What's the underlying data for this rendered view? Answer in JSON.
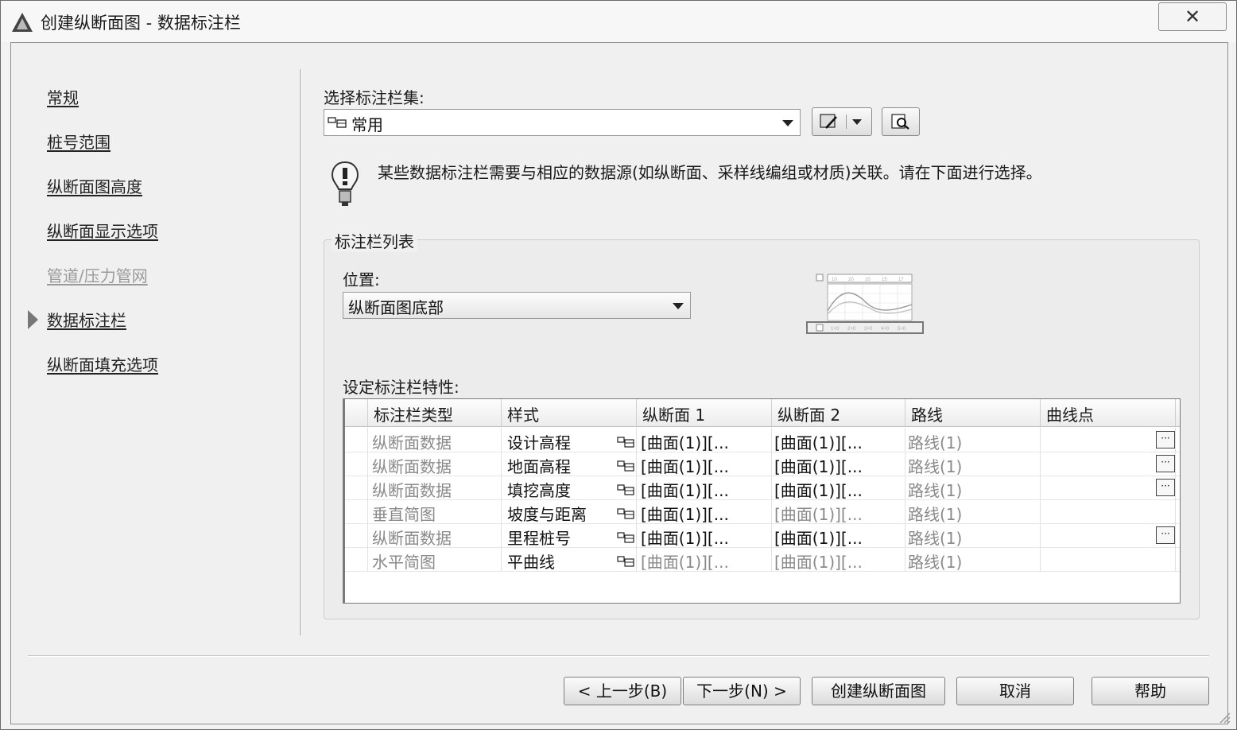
{
  "window": {
    "title": "创建纵断面图 - 数据标注栏",
    "close_glyph": "✕"
  },
  "nav": {
    "items": [
      {
        "label": "常规",
        "enabled": true
      },
      {
        "label": "桩号范围",
        "enabled": true
      },
      {
        "label": "纵断面图高度",
        "enabled": true
      },
      {
        "label": "纵断面显示选项",
        "enabled": true
      },
      {
        "label": "管道/压力管网",
        "enabled": false
      },
      {
        "label": "数据标注栏",
        "enabled": true,
        "current": true
      },
      {
        "label": "纵断面填充选项",
        "enabled": true
      }
    ]
  },
  "band_set": {
    "label": "选择标注栏集:",
    "value": "常用"
  },
  "info": {
    "text": "某些数据标注栏需要与相应的数据源(如纵断面、采样线编组或材质)关联。请在下面进行选择。"
  },
  "band_list": {
    "group_title": "标注栏列表",
    "location_label": "位置:",
    "location_value": "纵断面图底部",
    "properties_label": "设定标注栏特性:",
    "columns": [
      "标注栏类型",
      "样式",
      "纵断面 1",
      "纵断面 2",
      "路线",
      "曲线点"
    ],
    "rows": [
      {
        "type": "纵断面数据",
        "style": "设计高程",
        "profile1": "[曲面(1)][...",
        "profile2": "[曲面(1)][...",
        "alignment": "路线(1)",
        "p1_enabled": true,
        "p2_enabled": true,
        "has_curve_button": true
      },
      {
        "type": "纵断面数据",
        "style": "地面高程",
        "profile1": "[曲面(1)][...",
        "profile2": "[曲面(1)][...",
        "alignment": "路线(1)",
        "p1_enabled": true,
        "p2_enabled": true,
        "has_curve_button": true
      },
      {
        "type": "纵断面数据",
        "style": "填挖高度",
        "profile1": "[曲面(1)][...",
        "profile2": "[曲面(1)][...",
        "alignment": "路线(1)",
        "p1_enabled": true,
        "p2_enabled": true,
        "has_curve_button": true
      },
      {
        "type": "垂直简图",
        "style": "坡度与距离",
        "profile1": "[曲面(1)][...",
        "profile2": "[曲面(1)][...",
        "alignment": "路线(1)",
        "p1_enabled": true,
        "p2_enabled": false,
        "has_curve_button": false
      },
      {
        "type": "纵断面数据",
        "style": "里程桩号",
        "profile1": "[曲面(1)][...",
        "profile2": "[曲面(1)][...",
        "alignment": "路线(1)",
        "p1_enabled": true,
        "p2_enabled": true,
        "has_curve_button": true
      },
      {
        "type": "水平简图",
        "style": "平曲线",
        "profile1": "[曲面(1)][...",
        "profile2": "[曲面(1)][...",
        "alignment": "路线(1)",
        "p1_enabled": false,
        "p2_enabled": false,
        "has_curve_button": false
      }
    ],
    "ellipsis": "···"
  },
  "preview": {
    "top_ticks": [
      "10",
      "20",
      "10",
      "15",
      "17"
    ],
    "bottom_ticks": [
      "1+0",
      "2+0",
      "3+0",
      "4+0",
      "5+0"
    ]
  },
  "buttons": {
    "back": "< 上一步(B)",
    "next": "下一步(N) >",
    "create": "创建纵断面图",
    "cancel": "取消",
    "help": "帮助"
  },
  "colors": {
    "background": "#f0f0f0",
    "disabled_text": "#8a8a8a"
  }
}
